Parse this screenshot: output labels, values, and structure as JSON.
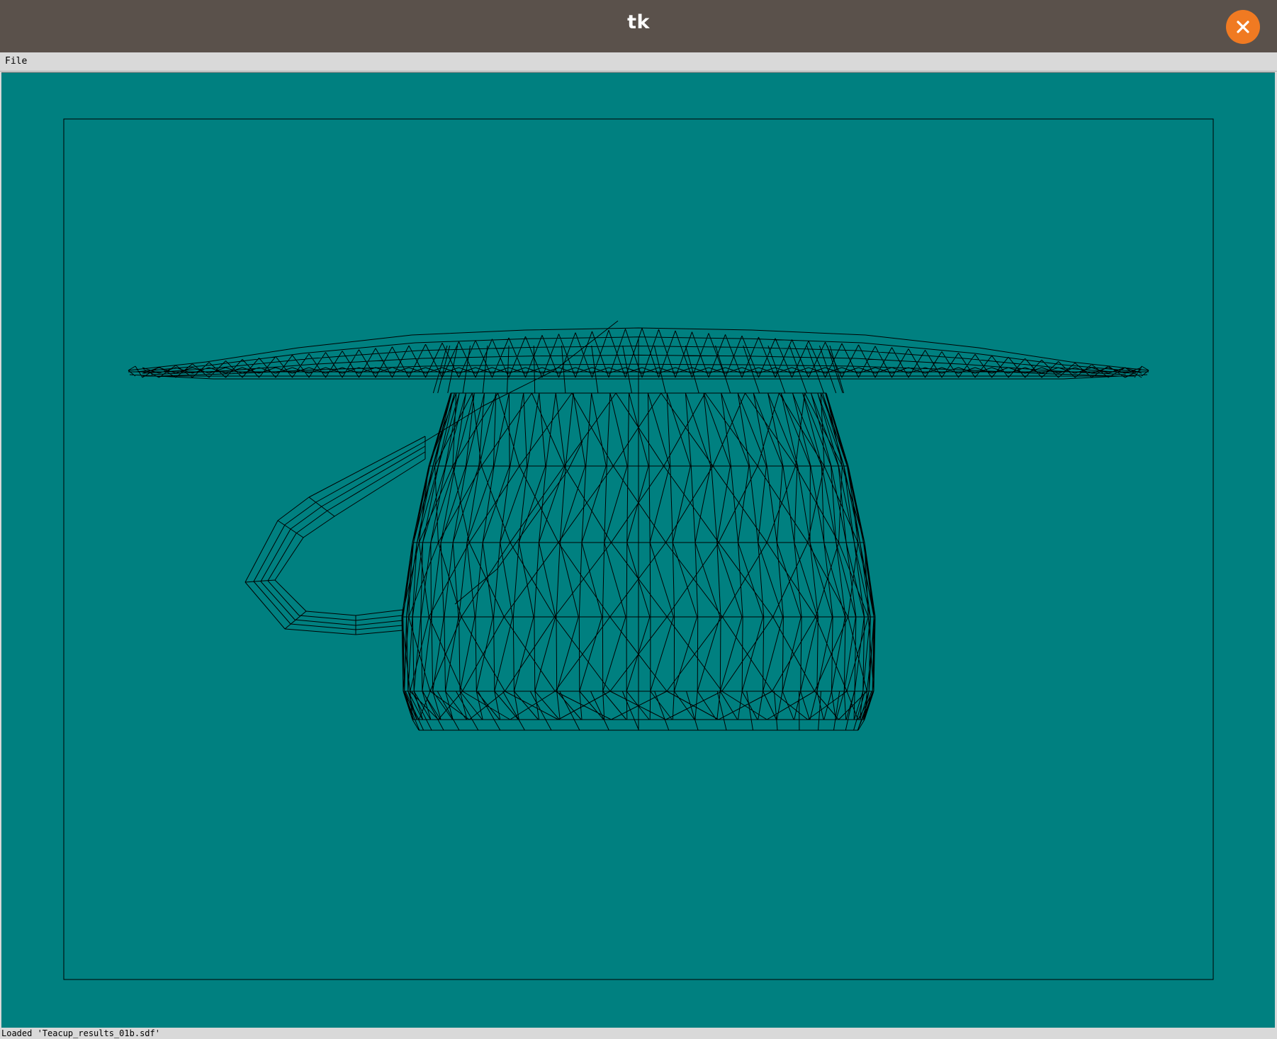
{
  "window": {
    "title": "tk",
    "close_icon": "close-icon",
    "close_color": "#f07a22",
    "titlebar_color": "#5a514b"
  },
  "menubar": {
    "items": [
      {
        "label": "File"
      }
    ]
  },
  "canvas": {
    "background": "#008080",
    "line_color": "#000000",
    "content": "wireframe-teacup-and-saucer"
  },
  "status": {
    "text": "Loaded 'Teacup_results_01b.sdf'"
  }
}
